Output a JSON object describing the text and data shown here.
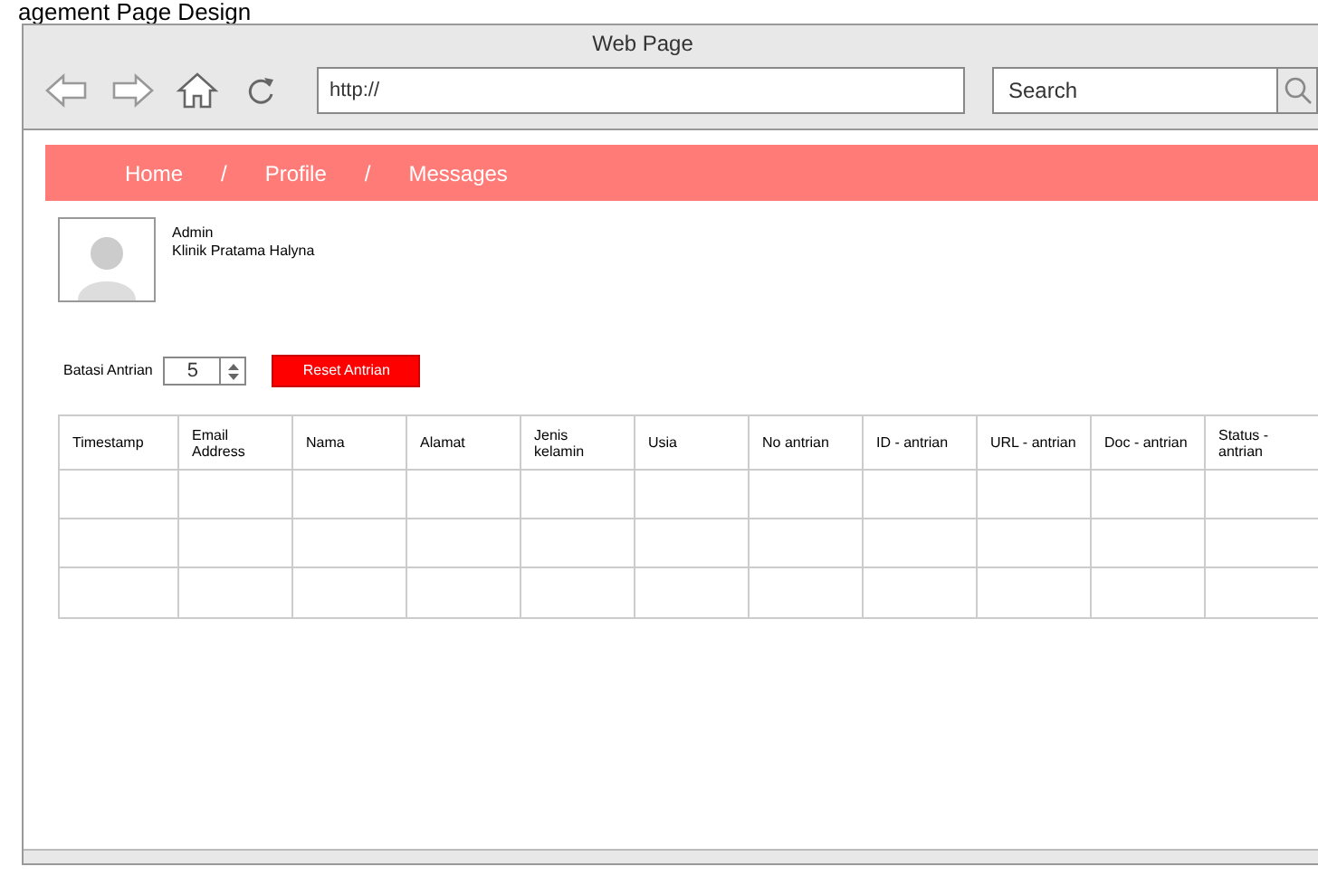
{
  "page_title": "agement Page Design",
  "window": {
    "title": "Web Page"
  },
  "address_bar": {
    "value": "http://"
  },
  "search": {
    "placeholder": "Search"
  },
  "nav": [
    "Home",
    "Profile",
    "Messages"
  ],
  "nav_separator": "/",
  "profile": {
    "name": "Admin",
    "organization": "Klinik Pratama Halyna"
  },
  "queue_limit": {
    "label": "Batasi Antrian",
    "value": "5"
  },
  "reset_button": "Reset Antrian",
  "table": {
    "columns": [
      "Timestamp",
      "Email Address",
      "Nama",
      "Alamat",
      "Jenis kelamin",
      "Usia",
      "No antrian",
      "ID - antrian",
      "URL - antrian",
      "Doc - antrian",
      "Status - antrian"
    ]
  }
}
